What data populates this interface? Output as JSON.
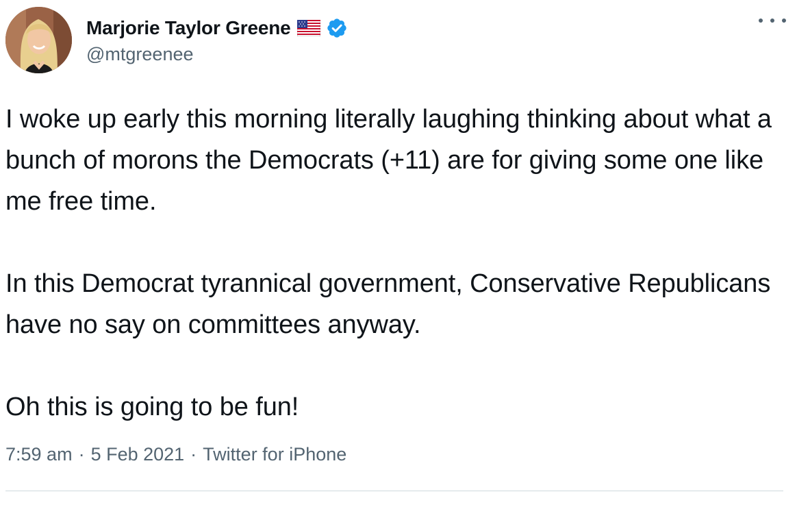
{
  "user": {
    "display_name": "Marjorie Taylor Greene",
    "handle": "@mtgreenee",
    "flag_icon": "us-flag-icon",
    "verified_icon": "verified-badge-icon",
    "verified_color": "#1d9bf0"
  },
  "tweet": {
    "paragraphs": [
      "I woke up early this morning literally laughing thinking about what a bunch of morons the Democrats (+11) are for giving some one like me free time.",
      "In this Democrat tyrannical government, Conservative Republicans have no say on committees anyway.",
      "Oh this is going to be fun!"
    ]
  },
  "meta": {
    "time": "7:59 am",
    "separator": "·",
    "date": "5 Feb 2021",
    "source": "Twitter for iPhone"
  },
  "menu": {
    "icon": "more-options-icon"
  },
  "colors": {
    "text": "#0f1419",
    "secondary": "#536471",
    "divider": "#cfd9de"
  }
}
